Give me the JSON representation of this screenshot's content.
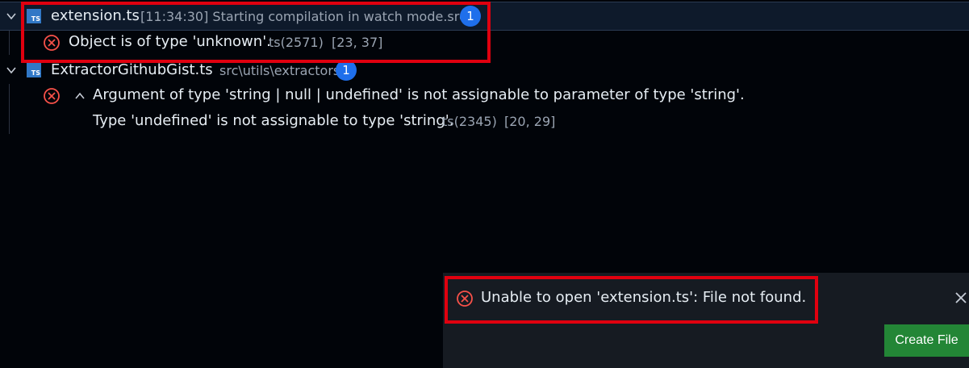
{
  "problems": {
    "files": [
      {
        "name": "extension.ts",
        "icon": "typescript-file-icon",
        "icon_label": "TS",
        "description": "[11:34:30] Starting compilation in watch mode.src",
        "count": "1",
        "errors": [
          {
            "message": "Object is of type 'unknown'.",
            "code": "ts(2571)",
            "location": "[23, 37]"
          }
        ]
      },
      {
        "name": "ExtractorGithubGist.ts",
        "icon": "typescript-file-icon",
        "icon_label": "TS",
        "description": "src\\utils\\extractors",
        "count": "1",
        "errors": [
          {
            "message": "Argument of type 'string | null | undefined' is not assignable to parameter of type 'string'.",
            "detail": "Type 'undefined' is not assignable to type 'string'.",
            "code": "ts(2345)",
            "location": "[20, 29]"
          }
        ]
      }
    ]
  },
  "notification": {
    "message": "Unable to open 'extension.ts': File not found.",
    "action_label": "Create File",
    "icon": "error-circle-icon",
    "close_icon": "close-icon"
  },
  "colors": {
    "background": "#010409",
    "error": "#f85149",
    "badge": "#1f6feb",
    "ts_icon": "#3178c6",
    "highlight": "#e0000f",
    "button": "#238636"
  }
}
